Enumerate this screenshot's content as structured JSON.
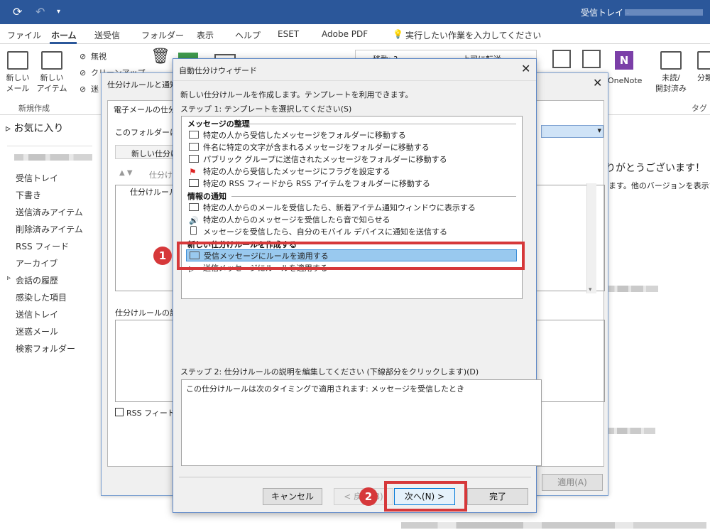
{
  "window": {
    "title": "受信トレイ -"
  },
  "tabs": [
    "ファイル",
    "ホーム",
    "送受信",
    "フォルダー",
    "表示",
    "ヘルプ",
    "ESET",
    "Adobe PDF"
  ],
  "tell_me": "実行したい作業を入力してください",
  "ribbon": {
    "new_mail": "新しい\nメール",
    "new_items": "新しい\nアイテム",
    "ignore": "無視",
    "cleanup": "クリーンアップ",
    "junk": "迷",
    "group_new": "新規作成",
    "move": "移動: ?",
    "forward": "上司に転送",
    "onenote": "OneNote",
    "unread": "未読/\n開封済み",
    "categorize": "分類",
    "group_tags": "タグ"
  },
  "nav": {
    "favorites": "お気に入り",
    "folders": [
      "受信トレイ",
      "下書き",
      "送信済みアイテム",
      "削除済みアイテム",
      "RSS フィード",
      "アーカイブ",
      "会話の履歴",
      "感染した項目",
      "送信トレイ",
      "迷惑メール",
      "検索フォルダー"
    ]
  },
  "reading": {
    "thanks": "りがとうございます！",
    "sub": "ます。他のバージョンを表示する"
  },
  "rules_dialog": {
    "title": "仕分けルールと通知",
    "tab": "電子メールの仕分",
    "folder_label": "このフォルダーに変",
    "new_rule": "新しい仕分け",
    "sort_label": "仕分け",
    "col_header": "仕分けルール",
    "desc_label": "仕分けルールの説",
    "rss_checkbox": "RSS フィードか",
    "apply": "適用(A)"
  },
  "wizard": {
    "title": "自動仕分けウィザード",
    "intro": "新しい仕分けルールを作成します。テンプレートを利用できます。",
    "step1": "ステップ 1: テンプレートを選択してください(S)",
    "sections": [
      {
        "title": "メッセージの整理",
        "items": [
          {
            "icon": "folder-move-icon",
            "label": "特定の人から受信したメッセージをフォルダーに移動する"
          },
          {
            "icon": "folder-move-icon",
            "label": "件名に特定の文字が含まれるメッセージをフォルダーに移動する"
          },
          {
            "icon": "folder-move-icon",
            "label": "パブリック グループに送信されたメッセージをフォルダーに移動する"
          },
          {
            "icon": "flag-icon",
            "label": "特定の人から受信したメッセージにフラグを設定する"
          },
          {
            "icon": "folder-move-icon",
            "label": "特定の RSS フィードから RSS アイテムをフォルダーに移動する"
          }
        ]
      },
      {
        "title": "情報の通知",
        "items": [
          {
            "icon": "alert-mail-icon",
            "label": "特定の人からのメールを受信したら、新着アイテム通知ウィンドウに表示する"
          },
          {
            "icon": "speaker-icon",
            "label": "特定の人からのメッセージを受信したら音で知らせる"
          },
          {
            "icon": "mobile-icon",
            "label": "メッセージを受信したら、自分のモバイル デバイスに通知を送信する"
          }
        ]
      },
      {
        "title": "新しい仕分けルールを作成する",
        "items": [
          {
            "icon": "envelope-icon",
            "label": "受信メッセージにルールを適用する",
            "selected": true
          },
          {
            "icon": "send-icon",
            "label": "送信メッセージにルールを適用する"
          }
        ]
      }
    ],
    "step2": "ステップ 2: 仕分けルールの説明を編集してください (下線部分をクリックします)(D)",
    "description": "この仕分けルールは次のタイミングで適用されます: メッセージを受信したとき",
    "buttons": {
      "cancel": "キャンセル",
      "back": "< 戻る(B)",
      "next": "次へ(N) >",
      "finish": "完了"
    }
  },
  "callouts": {
    "one": "1",
    "two": "2"
  },
  "colors": {
    "titlebar": "#2b579a",
    "selection": "#99c9ef",
    "callout": "#d6383a"
  }
}
